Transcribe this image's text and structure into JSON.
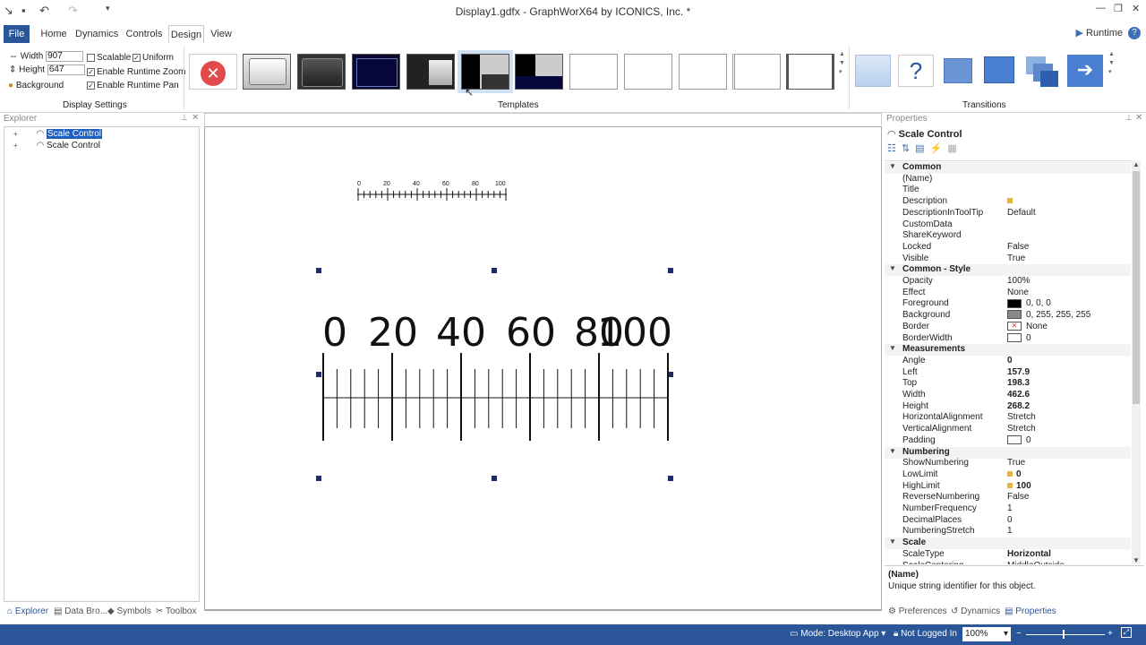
{
  "window": {
    "title": "Display1.gdfx - GraphWorX64 by ICONICS, Inc. *"
  },
  "menu": {
    "tabs": [
      "File",
      "Home",
      "Dynamics",
      "Controls",
      "Design",
      "View"
    ],
    "active": "Design",
    "runtime_label": "Runtime",
    "help": "?"
  },
  "display_settings": {
    "width_label": "Width",
    "width_value": "907",
    "height_label": "Height",
    "height_value": "647",
    "background_label": "Background",
    "scalable_label": "Scalable",
    "uniform_label": "Uniform",
    "zoom_label": "Enable Runtime Zoom",
    "pan_label": "Enable Runtime Pan",
    "scalable_checked": false,
    "uniform_checked": true,
    "zoom_checked": true,
    "pan_checked": true,
    "group_label": "Display Settings"
  },
  "templates": {
    "group_label": "Templates",
    "selected_index": 4
  },
  "transitions": {
    "group_label": "Transitions"
  },
  "explorer": {
    "header": "Explorer",
    "items": [
      "Scale Control",
      "Scale Control"
    ],
    "bottom_tabs": [
      "Explorer",
      "Data Bro...",
      "Symbols",
      "Toolbox"
    ]
  },
  "canvas": {
    "small_scale_labels": [
      "0",
      "20",
      "40",
      "60",
      "80",
      "100"
    ],
    "large_scale_labels": [
      "0",
      "20",
      "40",
      "60",
      "80",
      "100"
    ]
  },
  "properties": {
    "header": "Properties",
    "object_title": "Scale Control",
    "rows": [
      {
        "type": "cat",
        "name": "Common"
      },
      {
        "name": "(Name)",
        "value": ""
      },
      {
        "name": "Title",
        "value": ""
      },
      {
        "name": "Description",
        "value": "",
        "dot": true
      },
      {
        "name": "DescriptionInToolTip",
        "value": "Default"
      },
      {
        "name": "CustomData",
        "value": ""
      },
      {
        "name": "ShareKeyword",
        "value": ""
      },
      {
        "name": "Locked",
        "value": "False"
      },
      {
        "name": "Visible",
        "value": "True"
      },
      {
        "type": "cat",
        "name": "Common - Style"
      },
      {
        "name": "Opacity",
        "value": "100%"
      },
      {
        "name": "Effect",
        "value": "None"
      },
      {
        "name": "Foreground",
        "value": "0, 0, 0",
        "swatch": "#000000"
      },
      {
        "name": "Background",
        "value": "0, 255, 255, 255",
        "swatch": "#888888"
      },
      {
        "name": "Border",
        "value": "None",
        "swatch": "x"
      },
      {
        "name": "BorderWidth",
        "value": "0",
        "swatch": "#ffffff"
      },
      {
        "type": "cat",
        "name": "Measurements"
      },
      {
        "name": "Angle",
        "value": "0",
        "bold": true
      },
      {
        "name": "Left",
        "value": "157.9",
        "bold": true
      },
      {
        "name": "Top",
        "value": "198.3",
        "bold": true
      },
      {
        "name": "Width",
        "value": "462.6",
        "bold": true
      },
      {
        "name": "Height",
        "value": "268.2",
        "bold": true
      },
      {
        "name": "HorizontalAlignment",
        "value": "Stretch"
      },
      {
        "name": "VerticalAlignment",
        "value": "Stretch"
      },
      {
        "name": "Padding",
        "value": "0",
        "swatch": "#ffffff"
      },
      {
        "type": "cat",
        "name": "Numbering"
      },
      {
        "name": "ShowNumbering",
        "value": "True"
      },
      {
        "name": "LowLimit",
        "value": "0",
        "bold": true,
        "dot": true
      },
      {
        "name": "HighLimit",
        "value": "100",
        "bold": true,
        "dot": true
      },
      {
        "name": "ReverseNumbering",
        "value": "False"
      },
      {
        "name": "NumberFrequency",
        "value": "1"
      },
      {
        "name": "DecimalPlaces",
        "value": "0"
      },
      {
        "name": "NumberingStretch",
        "value": "1"
      },
      {
        "type": "cat",
        "name": "Scale"
      },
      {
        "name": "ScaleType",
        "value": "Horizontal",
        "bold": true
      },
      {
        "name": "ScaleCentering",
        "value": "MiddleOutside"
      }
    ],
    "help_title": "(Name)",
    "help_text": "Unique string identifier for this object.",
    "bottom_tabs": [
      "Preferences",
      "Dynamics",
      "Properties"
    ]
  },
  "status": {
    "mode": "Mode: Desktop App",
    "login": "Not Logged In",
    "zoom": "100%"
  }
}
